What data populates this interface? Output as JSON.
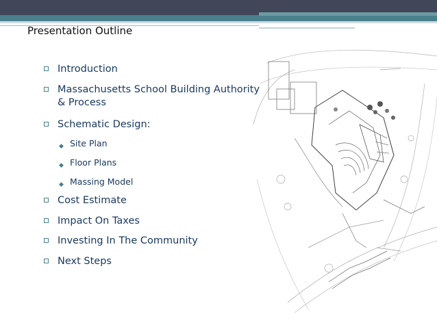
{
  "slide": {
    "title": "Presentation Outline",
    "outline": [
      {
        "label": "Introduction"
      },
      {
        "label_line1": "Massachusetts School Building Authority",
        "label_line2": "& Process"
      },
      {
        "label": "Schematic Design:"
      },
      {
        "sub": [
          "Site Plan",
          "Floor Plans",
          "Massing Model"
        ]
      },
      {
        "label": "Cost Estimate"
      },
      {
        "label": "Impact On Taxes"
      },
      {
        "label": "Investing In The Community"
      },
      {
        "label": "Next Steps"
      }
    ]
  },
  "colors": {
    "header_dark": "#414659",
    "header_teal": "#4a7f8c",
    "text": "#17375e"
  },
  "image": {
    "type": "site-plan-drawing"
  }
}
